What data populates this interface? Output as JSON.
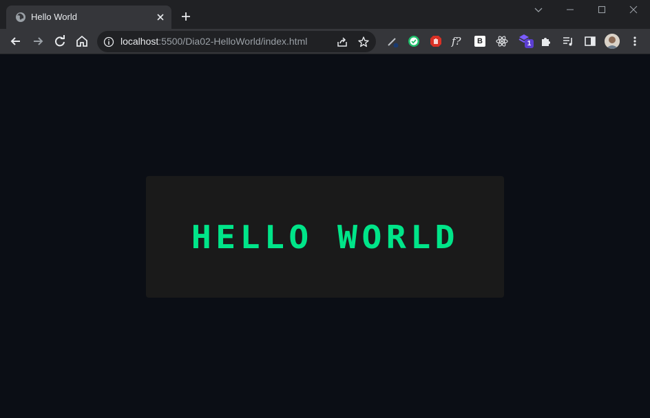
{
  "browser": {
    "tab": {
      "title": "Hello World"
    },
    "address": {
      "host": "localhost",
      "rest": ":5500/Dia02-HelloWorld/index.html"
    },
    "extensions": {
      "function_label": "f?",
      "bootstrap_label": "B",
      "badge_count": "1"
    }
  },
  "page": {
    "heading": "HELLO WORLD"
  },
  "colors": {
    "accent": "#00e589",
    "page_bg": "#0b0e15",
    "card_bg": "#1a1a1a"
  }
}
